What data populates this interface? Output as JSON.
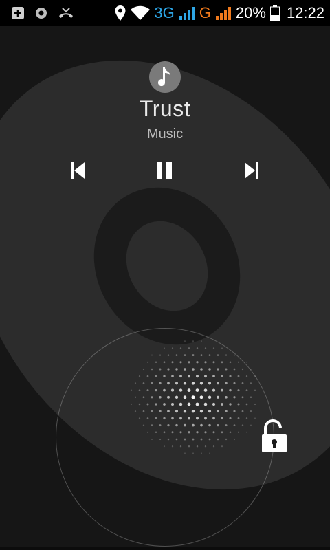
{
  "status_bar": {
    "left_icons": [
      "add-notification-icon",
      "media-record-icon",
      "missed-call-icon"
    ],
    "right_icons": [
      "location-icon",
      "wifi-icon",
      "signal-3g-icon",
      "signal-g-icon",
      "battery-icon"
    ],
    "network_3g": "3G",
    "network_g": "G",
    "battery_percent": "20%",
    "time": "12:22",
    "colors": {
      "net_3g": "#2ea6e6",
      "net_g": "#f07a1c"
    }
  },
  "music": {
    "title": "Trust",
    "source": "Music",
    "icon": "music-note-icon"
  },
  "controls": {
    "previous_icon": "skip-previous-icon",
    "pause_icon": "pause-icon",
    "next_icon": "skip-next-icon"
  },
  "lockscreen": {
    "unlock_icon": "unlock-icon"
  }
}
